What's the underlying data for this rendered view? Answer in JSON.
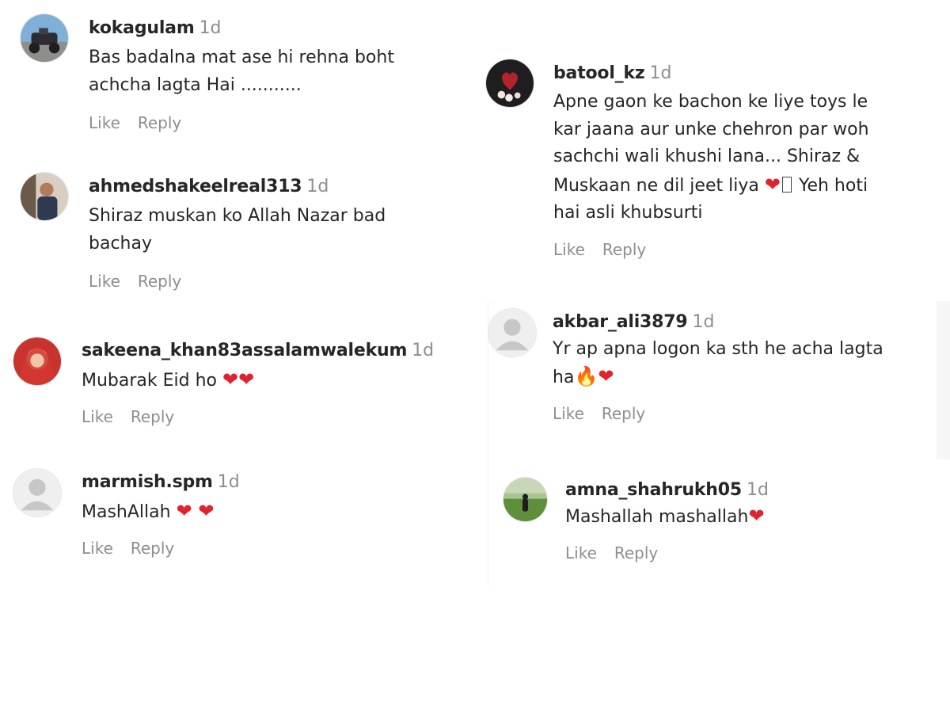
{
  "comments": [
    {
      "username": "kokagulam",
      "time": "1d",
      "text_lines": [
        "Bas badalna mat ase hi rehna boht",
        "achcha lagta Hai ..........."
      ],
      "like": "Like",
      "reply": "Reply",
      "avatar_icon": "motorbike-photo-avatar"
    },
    {
      "username": "ahmedshakeelreal313",
      "time": "1d",
      "text_lines": [
        "Shiraz muskan ko Allah Nazar bad",
        "bachay"
      ],
      "like": "Like",
      "reply": "Reply",
      "avatar_icon": "man-photo-avatar"
    },
    {
      "username": "sakeena_khan83assalamwalekum",
      "time": "1d",
      "text_lines": [
        "Mubarak Eid ho"
      ],
      "emoji": "❤❤",
      "like": "Like",
      "reply": "Reply",
      "avatar_icon": "red-scarf-photo-avatar"
    },
    {
      "username": "marmish.spm",
      "time": "1d",
      "text_lines": [
        "MashAllah"
      ],
      "emoji": "❤ ❤",
      "like": "Like",
      "reply": "Reply",
      "avatar_icon": "default-user-avatar"
    },
    {
      "username": "batool_kz",
      "time": "1d",
      "text_lines": [
        "Apne gaon ke bachon ke liye toys le",
        "kar jaana aur unke chehron par woh",
        "sachchi wali khushi lana... Shiraz &",
        "Muskaan ne dil jeet liya",
        "hai asli khubsurti"
      ],
      "inline_after": "Yeh hoti",
      "emoji": "❤",
      "like": "Like",
      "reply": "Reply",
      "avatar_icon": "heart-balloons-photo-avatar"
    },
    {
      "username": "akbar_ali3879",
      "time": "1d",
      "text_lines": [
        "Yr ap apna logon ka sth he acha lagta",
        "ha"
      ],
      "emoji_fire": "🔥",
      "emoji": "❤",
      "like": "Like",
      "reply": "Reply",
      "avatar_icon": "default-user-avatar"
    },
    {
      "username": "amna_shahrukh05",
      "time": "1d",
      "text_lines": [
        "Mashallah mashallah"
      ],
      "emoji": "❤",
      "like": "Like",
      "reply": "Reply",
      "avatar_icon": "green-field-photo-avatar"
    }
  ],
  "colors": {
    "text": "#262626",
    "muted": "#8e8e8e",
    "heart": "#e0242e",
    "fire": "#f26b1d"
  }
}
